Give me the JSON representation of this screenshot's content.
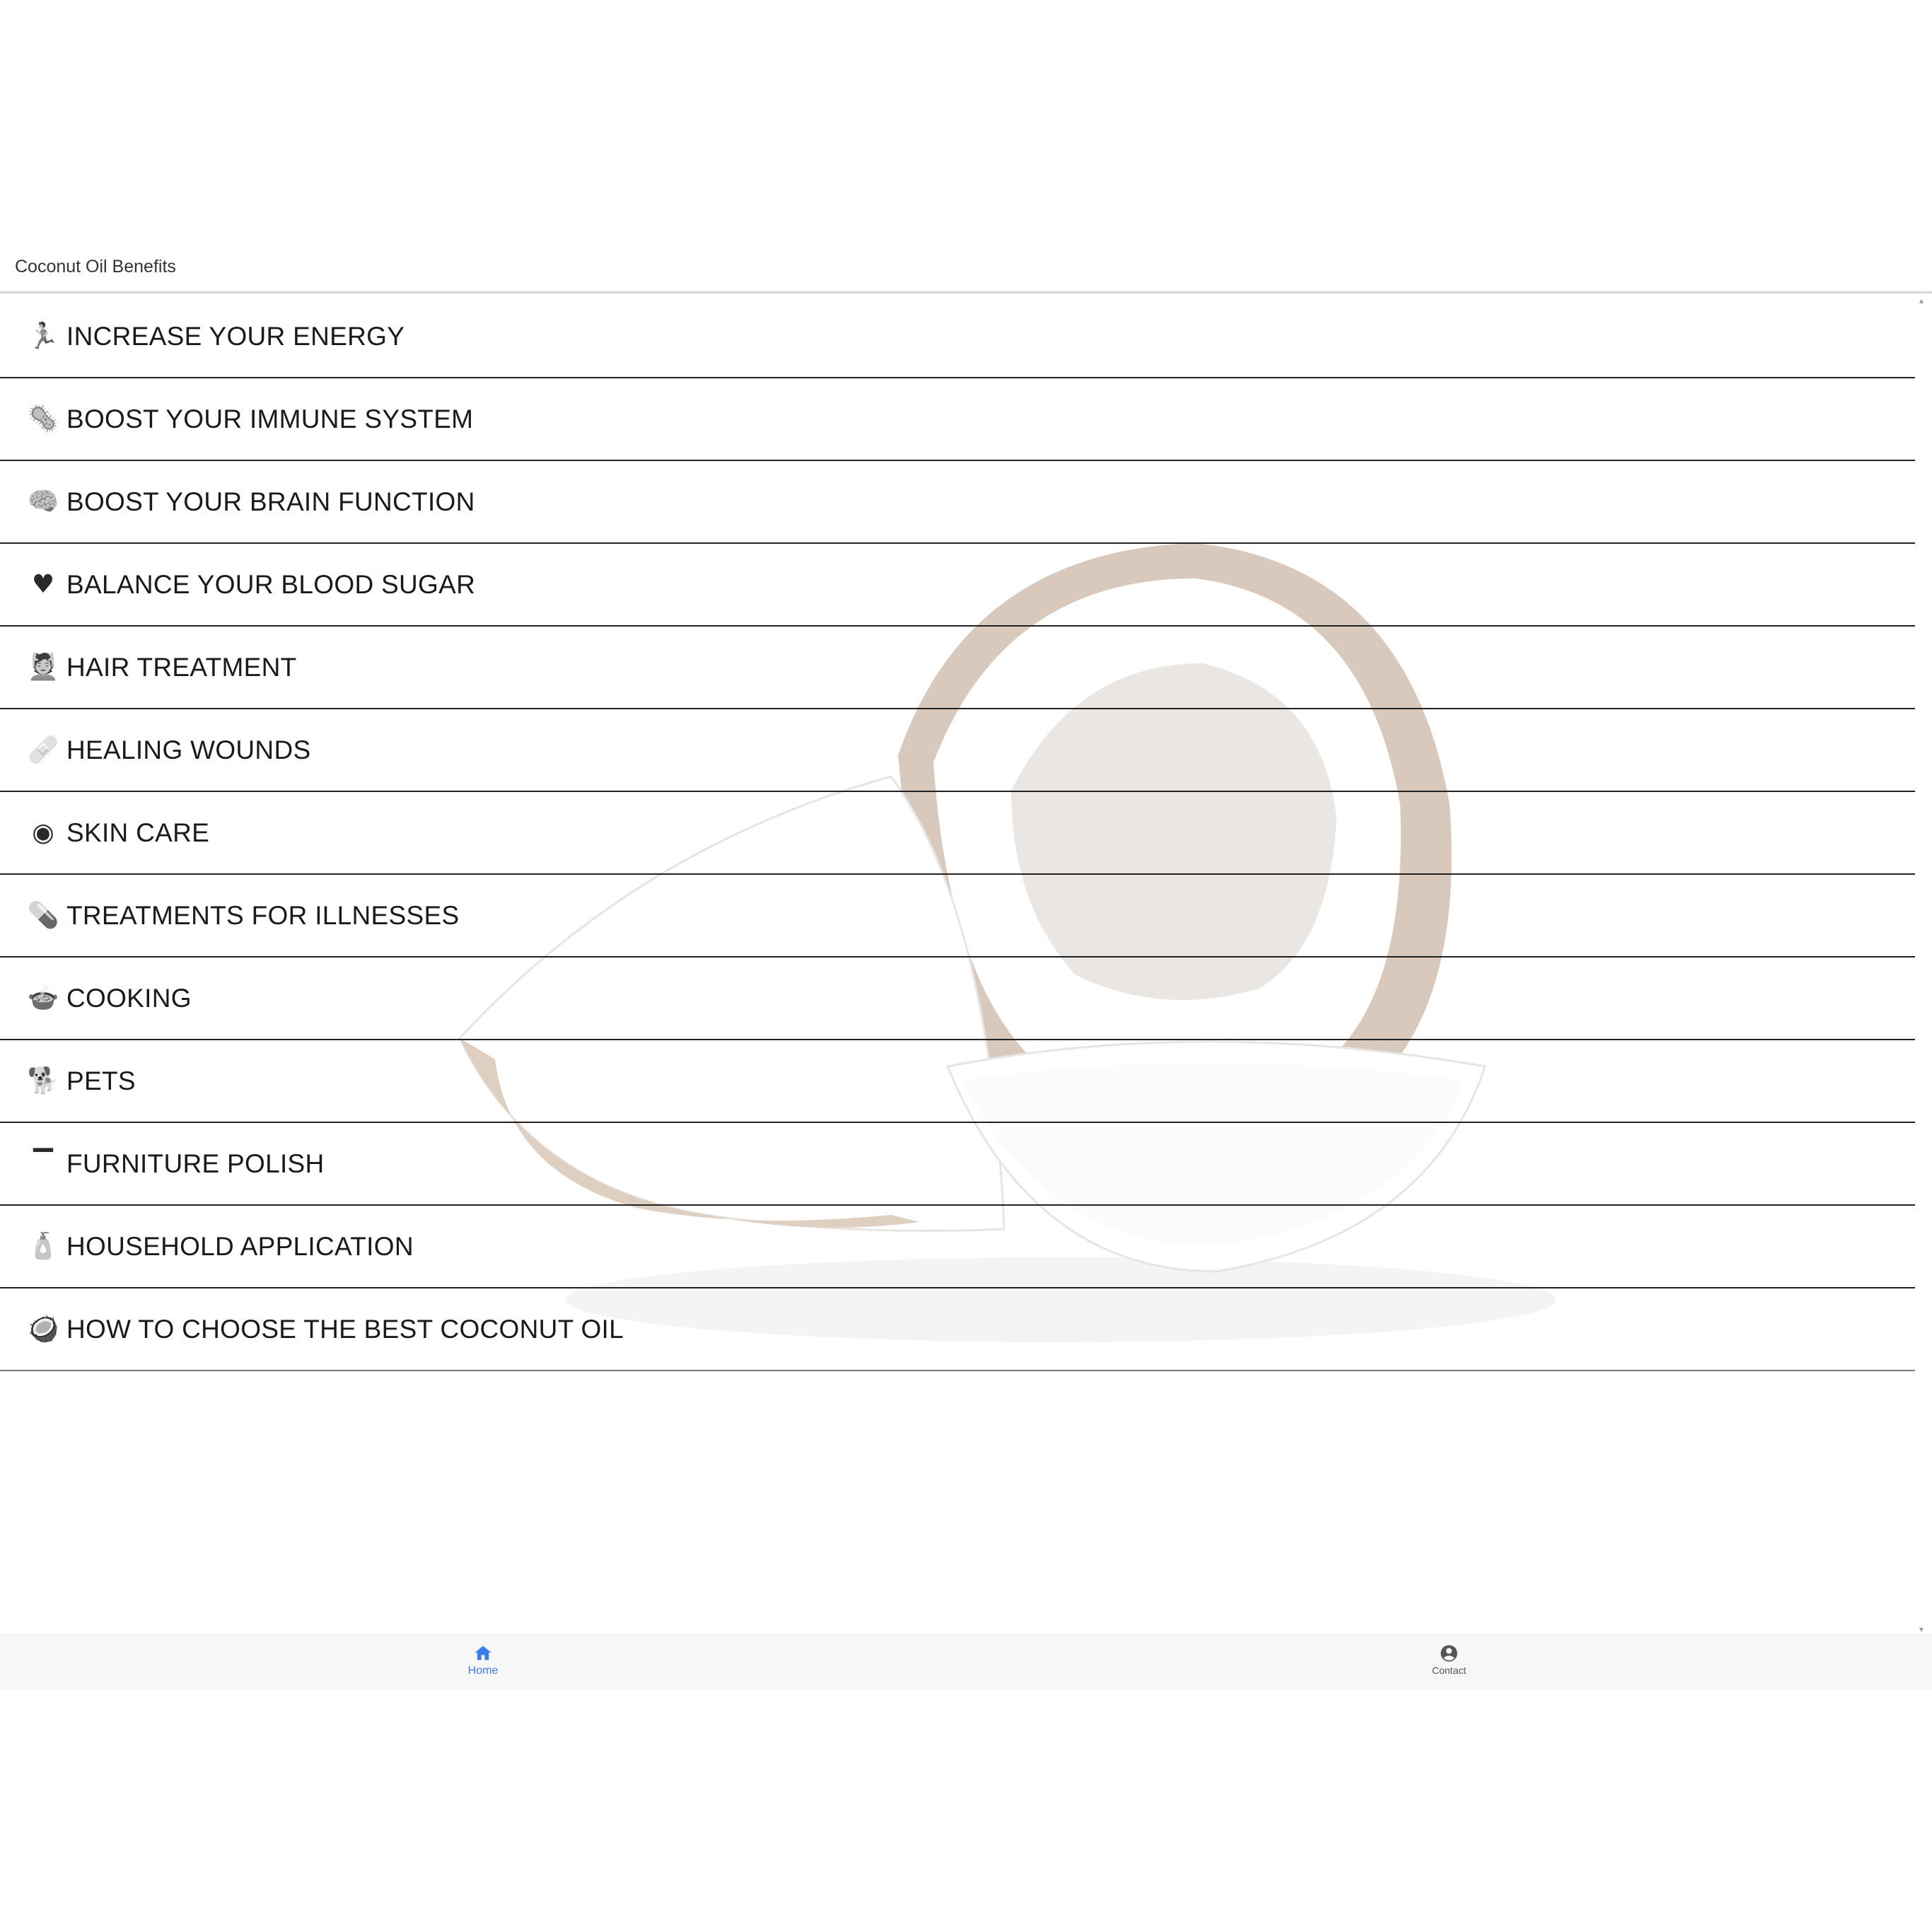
{
  "header": {
    "title": "Coconut Oil Benefits"
  },
  "menu": {
    "items": [
      {
        "icon": "exercise-icon",
        "glyph": "🏃",
        "label": "INCREASE YOUR ENERGY"
      },
      {
        "icon": "microbe-icon",
        "glyph": "🦠",
        "label": "BOOST YOUR IMMUNE SYSTEM"
      },
      {
        "icon": "brain-icon",
        "glyph": "🧠",
        "label": "BOOST YOUR BRAIN FUNCTION"
      },
      {
        "icon": "heart-icon",
        "glyph": "♥",
        "label": "BALANCE YOUR BLOOD SUGAR"
      },
      {
        "icon": "hair-care-icon",
        "glyph": "💆",
        "label": "HAIR TREATMENT"
      },
      {
        "icon": "bandage-icon",
        "glyph": "🩹",
        "label": "HEALING WOUNDS"
      },
      {
        "icon": "skin-icon",
        "glyph": "◉",
        "label": "SKIN CARE"
      },
      {
        "icon": "medicine-bottle-icon",
        "glyph": "💊",
        "label": "TREATMENTS FOR ILLNESSES"
      },
      {
        "icon": "cooking-pot-icon",
        "glyph": "🍲",
        "label": "COOKING"
      },
      {
        "icon": "dog-icon",
        "glyph": "🐕",
        "label": "PETS"
      },
      {
        "icon": "table-icon",
        "glyph": "▔",
        "label": "FURNITURE POLISH"
      },
      {
        "icon": "household-icon",
        "glyph": "🧴",
        "label": "HOUSEHOLD APPLICATION"
      },
      {
        "icon": "coconut-icon",
        "glyph": "🥥",
        "label": "HOW TO CHOOSE THE BEST COCONUT OIL"
      }
    ]
  },
  "tabbar": {
    "home_label": "Home",
    "contact_label": "Contact",
    "active_color": "#3b7df0"
  }
}
